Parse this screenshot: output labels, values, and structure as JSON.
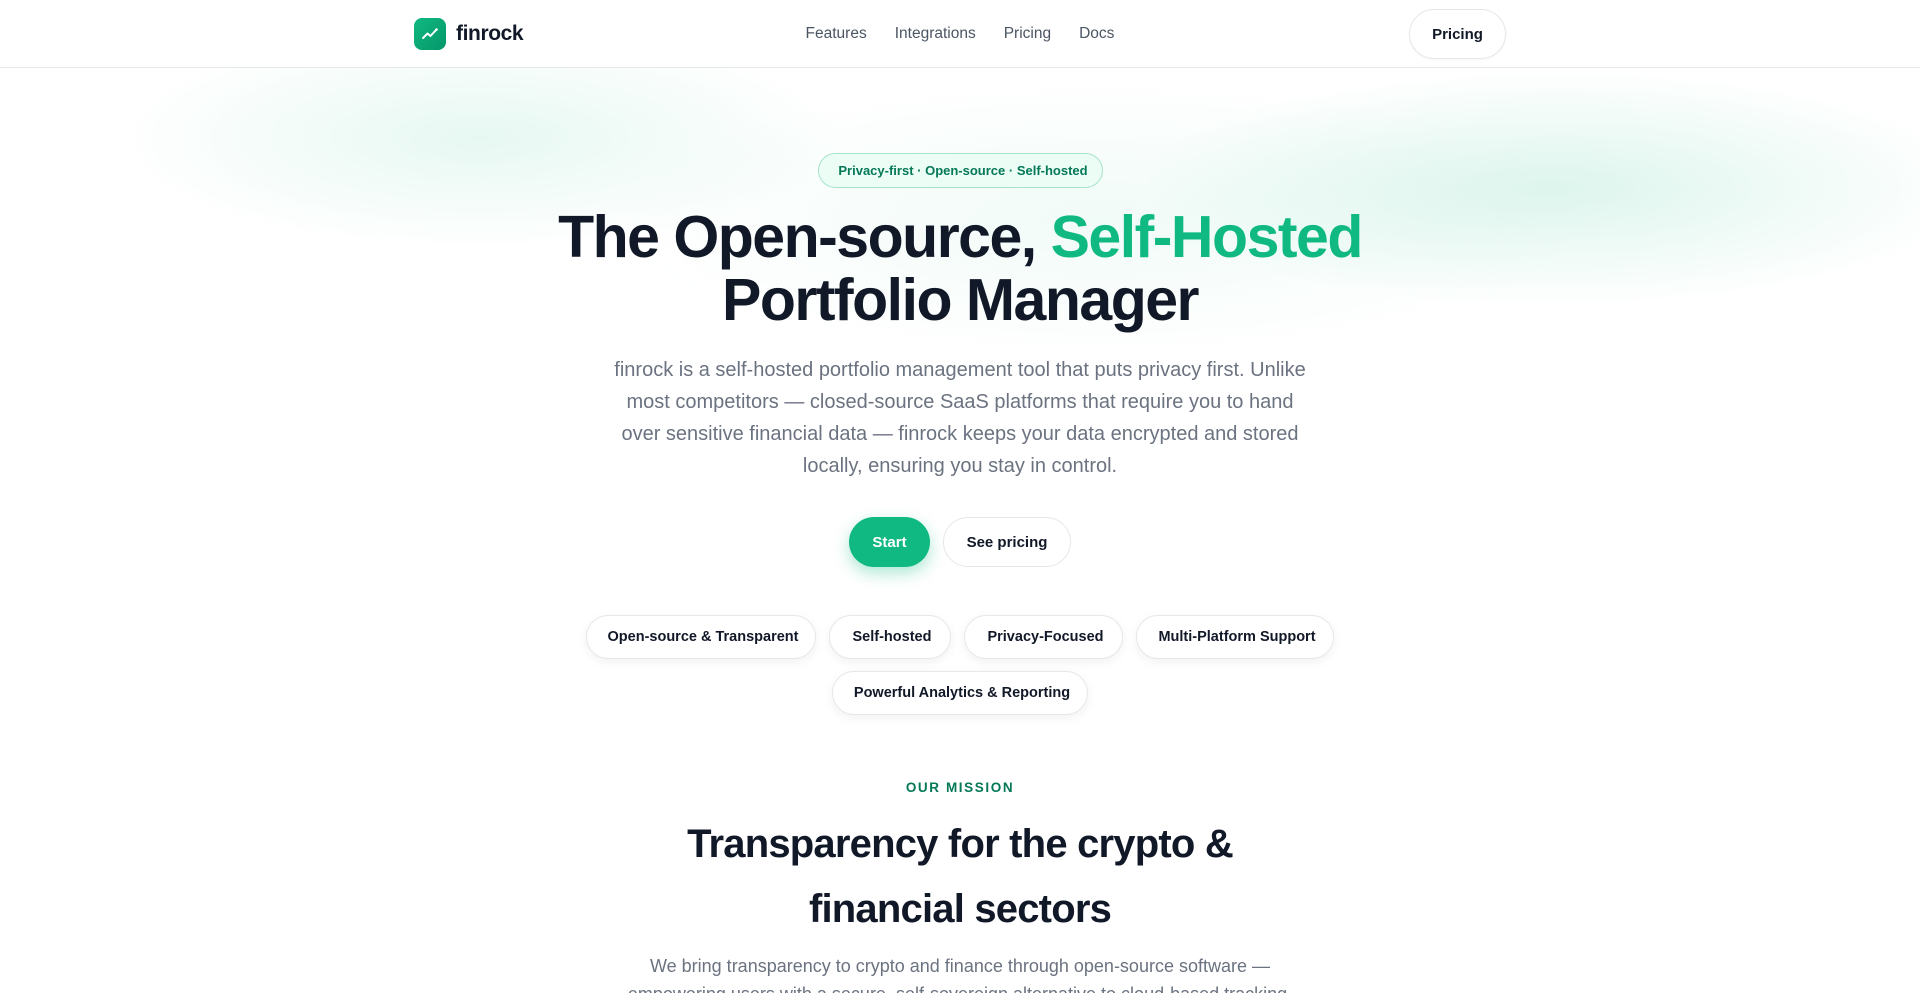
{
  "brand": {
    "name": "finrock",
    "logo_icon": "trend-up-icon",
    "accent_color": "#10b981"
  },
  "nav": {
    "links": [
      "Features",
      "Integrations",
      "Pricing",
      "Docs"
    ],
    "cta_label": "Pricing"
  },
  "hero": {
    "badge_glyph": "",
    "badge_text": "Privacy-first · Open-source · Self-hosted",
    "title_part1": "The Open-source, ",
    "title_accent": "Self-Hosted",
    "title_part2": "Portfolio Manager",
    "description": "finrock is a self-hosted portfolio management tool that puts privacy first. Unlike most competitors — closed-source SaaS platforms that require you to hand over sensitive financial data — finrock keeps your data encrypted and stored locally, ensuring you stay in control.",
    "primary_button": "Start",
    "secondary_button": "See pricing"
  },
  "features": [
    {
      "glyph": "",
      "label": "Open-source & Transparent"
    },
    {
      "glyph": "",
      "label": "Self-hosted"
    },
    {
      "glyph": "",
      "label": "Privacy-Focused"
    },
    {
      "glyph": "",
      "label": "Multi-Platform Support"
    },
    {
      "glyph": "",
      "label": "Powerful Analytics & Reporting"
    }
  ],
  "mission": {
    "eyebrow": "OUR MISSION",
    "title_line1": "Transparency for the crypto &",
    "title_line2": "financial sectors",
    "description": "We bring transparency to crypto and finance through open-source software — empowering users with a secure, self-sovereign alternative to cloud-based tracking."
  }
}
